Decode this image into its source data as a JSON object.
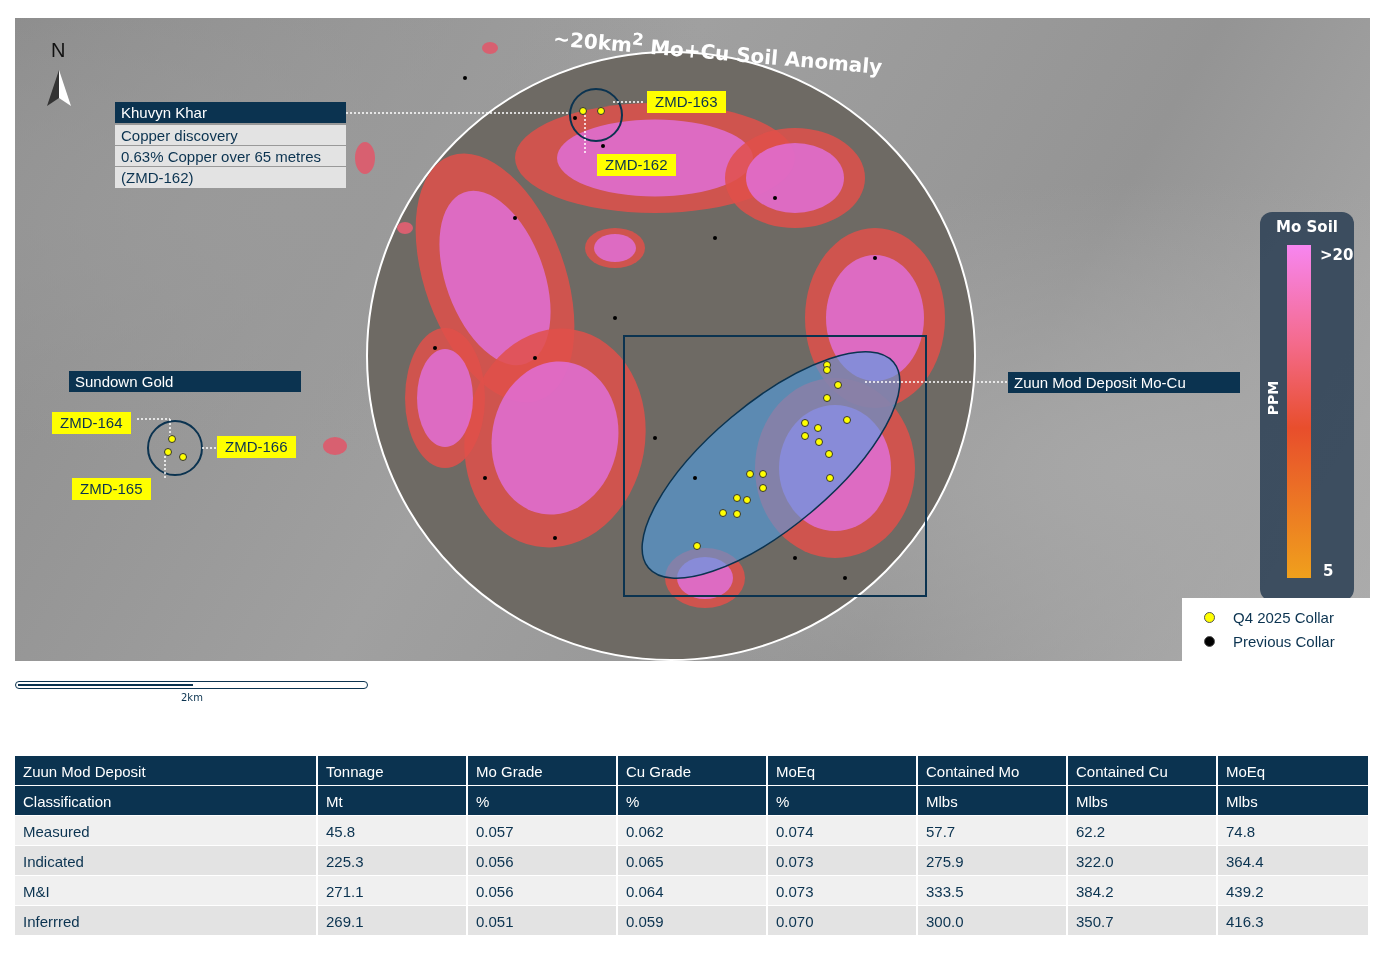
{
  "map": {
    "north_label": "N",
    "anomaly_title": "~20km$^{2}$ Mo+Cu Soil Anomaly",
    "khuvyn": {
      "title": "Khuvyn Khar",
      "details": [
        "Copper discovery",
        "0.63% Copper over 65 metres",
        "(ZMD-162)"
      ]
    },
    "area_labels": [
      "Sundown Gold",
      "Zuun Mod Deposit Mo-Cu"
    ],
    "hole_labels": [
      "ZMD-163",
      "ZMD-162",
      "ZMD-164",
      "ZMD-166",
      "ZMD-165"
    ],
    "soil_legend": {
      "title": "Mo Soil",
      "max": ">20",
      "min": "5",
      "unit": "PPM"
    },
    "collar_legend": [
      {
        "label": "Q4 2025 Collar",
        "color": "#ffff00"
      },
      {
        "label": "Previous Collar",
        "color": "#000000"
      }
    ],
    "scale_bar": {
      "label": "2km"
    }
  },
  "table": {
    "header_rows": [
      [
        "Zuun Mod Deposit",
        "Tonnage",
        "Mo Grade",
        "Cu Grade",
        "MoEq",
        "Contained Mo",
        "Contained Cu",
        "MoEq"
      ],
      [
        "Classification",
        "Mt",
        "%",
        "%",
        "%",
        "Mlbs",
        "Mlbs",
        "Mlbs"
      ]
    ],
    "rows": [
      [
        "Measured",
        "45.8",
        "0.057",
        "0.062",
        "0.074",
        "57.7",
        "62.2",
        "74.8"
      ],
      [
        "Indicated",
        "225.3",
        "0.056",
        "0.065",
        "0.073",
        "275.9",
        "322.0",
        "364.4"
      ],
      [
        "M&I",
        "271.1",
        "0.056",
        "0.064",
        "0.073",
        "333.5",
        "384.2",
        "439.2"
      ],
      [
        "Inferrred",
        "269.1",
        "0.051",
        "0.059",
        "0.070",
        "300.0",
        "350.7",
        "416.3"
      ]
    ]
  }
}
